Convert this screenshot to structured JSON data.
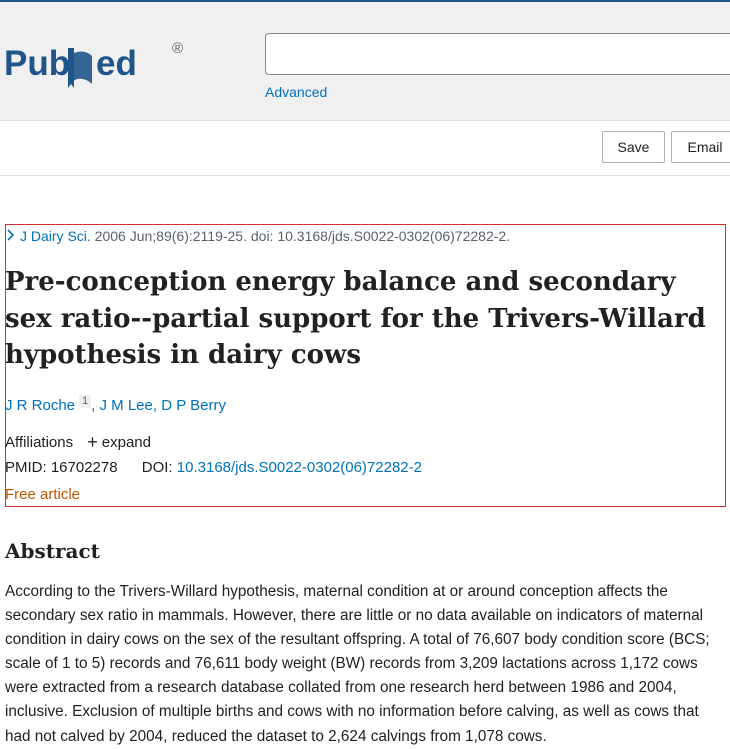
{
  "header": {
    "logo_text": "PubMed",
    "logo_reg": "®",
    "search_value": "",
    "advanced_label": "Advanced"
  },
  "toolbar": {
    "save_label": "Save",
    "email_label": "Email"
  },
  "article": {
    "journal": "J Dairy Sci.",
    "citation_rest": " 2006 Jun;89(6):2119-25. doi: 10.3168/jds.S0022-0302(06)72282-2.",
    "title": "Pre-conception energy balance and secondary sex ratio--partial support for the Trivers-Willard hypothesis in dairy cows",
    "authors": [
      {
        "name": "J R Roche",
        "affil_ref": "1"
      },
      {
        "name": "J M Lee"
      },
      {
        "name": "D P Berry"
      }
    ],
    "affiliations_label": "Affiliations",
    "expand_label": "expand",
    "pmid_label": "PMID:",
    "pmid": "16702278",
    "doi_label": "DOI:",
    "doi": "10.3168/jds.S0022-0302(06)72282-2",
    "free_label": "Free article"
  },
  "abstract": {
    "heading": "Abstract",
    "text": "According to the Trivers-Willard hypothesis, maternal condition at or around conception affects the secondary sex ratio in mammals. However, there are little or no data available on indicators of maternal condition in dairy cows on the sex of the resultant offspring. A total of 76,607 body condition score (BCS; scale of 1 to 5) records and 76,611 body weight (BW) records from 3,209 lactations across 1,172 cows were extracted from a research database collated from one research herd between 1986 and 2004, inclusive. Exclusion of multiple births and cows with no information before calving, as well as cows that had not calved by 2004, reduced the dataset to 2,624 calvings from 1,078 cows."
  },
  "colors": {
    "link": "#0071bc",
    "logo_blue": "#20558a",
    "highlight_border": "#d32f2f",
    "free_article": "#c05600"
  }
}
